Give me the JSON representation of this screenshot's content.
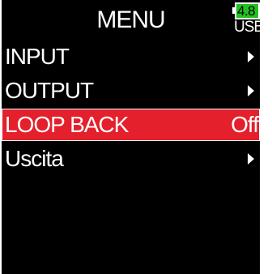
{
  "header": {
    "title": "MENU"
  },
  "status": {
    "battery_voltage": "4.8",
    "power_source": "USB",
    "battery_color": "#1fc320"
  },
  "menu": {
    "items": [
      {
        "label": "INPUT",
        "value": "",
        "icon": "chevron-right-icon",
        "selected": false
      },
      {
        "label": "OUTPUT",
        "value": "",
        "icon": "chevron-right-icon",
        "selected": false
      },
      {
        "label": "LOOP BACK",
        "value": "Off",
        "icon": "",
        "selected": true
      },
      {
        "label": "Uscita",
        "value": "",
        "icon": "chevron-right-icon",
        "selected": false
      }
    ],
    "selected_color": "#e3202b"
  }
}
